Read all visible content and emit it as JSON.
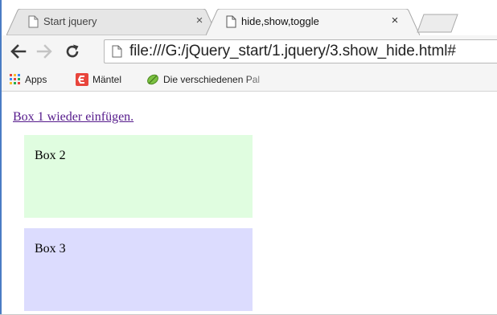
{
  "browser": {
    "tabs": [
      {
        "title": "Start jquery",
        "close": "×",
        "active": false
      },
      {
        "title": "hide,show,toggle",
        "close": "×",
        "active": true
      }
    ],
    "address_bar": {
      "url": "file:///G:/jQuery_start/1.jquery/3.show_hide.html#"
    },
    "bookmarks": [
      {
        "label": "Apps",
        "icon": "apps-grid-icon"
      },
      {
        "label": "Mäntel",
        "icon": "brand-e-icon"
      },
      {
        "label": "Die verschiedenen Pal",
        "icon": "leaf-icon"
      }
    ]
  },
  "page": {
    "restore_link": "Box 1 wieder einfügen.",
    "boxes": [
      {
        "label": "Box 2",
        "color": "#e0fde0"
      },
      {
        "label": "Box 3",
        "color": "#dcdcfe"
      }
    ]
  },
  "colors": {
    "visited_link": "#551a8b",
    "window_accent": "#4a7cc4",
    "toolbar_bg": "#f5f5f5"
  }
}
